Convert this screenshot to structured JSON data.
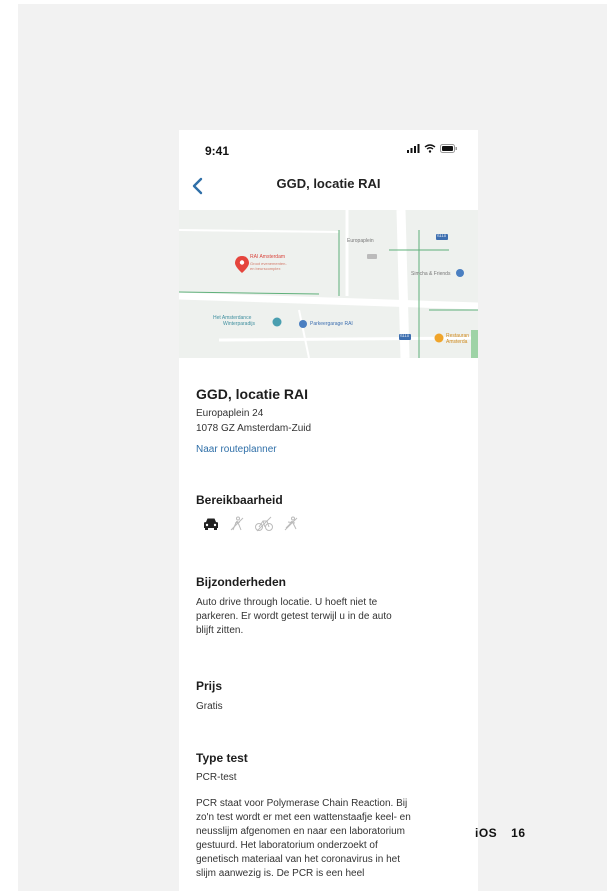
{
  "status_bar": {
    "time": "9:41"
  },
  "nav": {
    "title": "GGD, locatie RAI"
  },
  "map": {
    "labels": {
      "europaplein": "Europaplein",
      "rai_title": "RAI Amsterdam",
      "rai_sub1": "Groot evenementen-",
      "rai_sub2": "en beurscomplex",
      "simcha": "Simcha & Friends",
      "amsterdance_1": "Het Amsterdance",
      "amsterdance_2": "Winterparadijs",
      "parkeergarage": "Parkeergarage RAI",
      "restaurant_1": "Restauran",
      "restaurant_2": "Amsterda",
      "route_badge_1": "S110",
      "route_badge_2": "S110"
    }
  },
  "location": {
    "name": "GGD, locatie RAI",
    "street": "Europaplein 24",
    "city": "1078 GZ Amsterdam-Zuid",
    "route_link": "Naar routeplanner"
  },
  "reachability": {
    "heading": "Bereikbaarheid",
    "icons": [
      "car-icon",
      "walking-icon",
      "bicycle-icon",
      "running-icon"
    ]
  },
  "details": {
    "heading": "Bijzonderheden",
    "line1": "Auto drive through locatie. U hoeft niet te",
    "line2": "parkeren. Er wordt getest terwijl u in de auto",
    "line3": "blijft zitten."
  },
  "price": {
    "heading": "Prijs",
    "value": "Gratis"
  },
  "test_type": {
    "heading": "Type test",
    "value": "PCR-test",
    "desc1": "PCR staat voor Polymerase Chain Reaction. Bij",
    "desc2": "zo'n test wordt er met een wattenstaafje keel- en",
    "desc3": "neusslijm afgenomen en naar een laboratorium",
    "desc4": "gestuurd. Het laboratorium onderzoekt of",
    "desc5": "genetisch materiaal van het coronavirus in het",
    "desc6": "slijm aanwezig is. De PCR is een heel"
  },
  "slide": {
    "os_label": "iOS",
    "os_version": "16"
  },
  "colors": {
    "link": "#2f6fa8",
    "map_pin": "#e5453d",
    "map_bg": "#eef1ee",
    "green_line": "#5fb07a",
    "blue_poi": "#4a7fc1",
    "orange_poi": "#f0a52b"
  }
}
